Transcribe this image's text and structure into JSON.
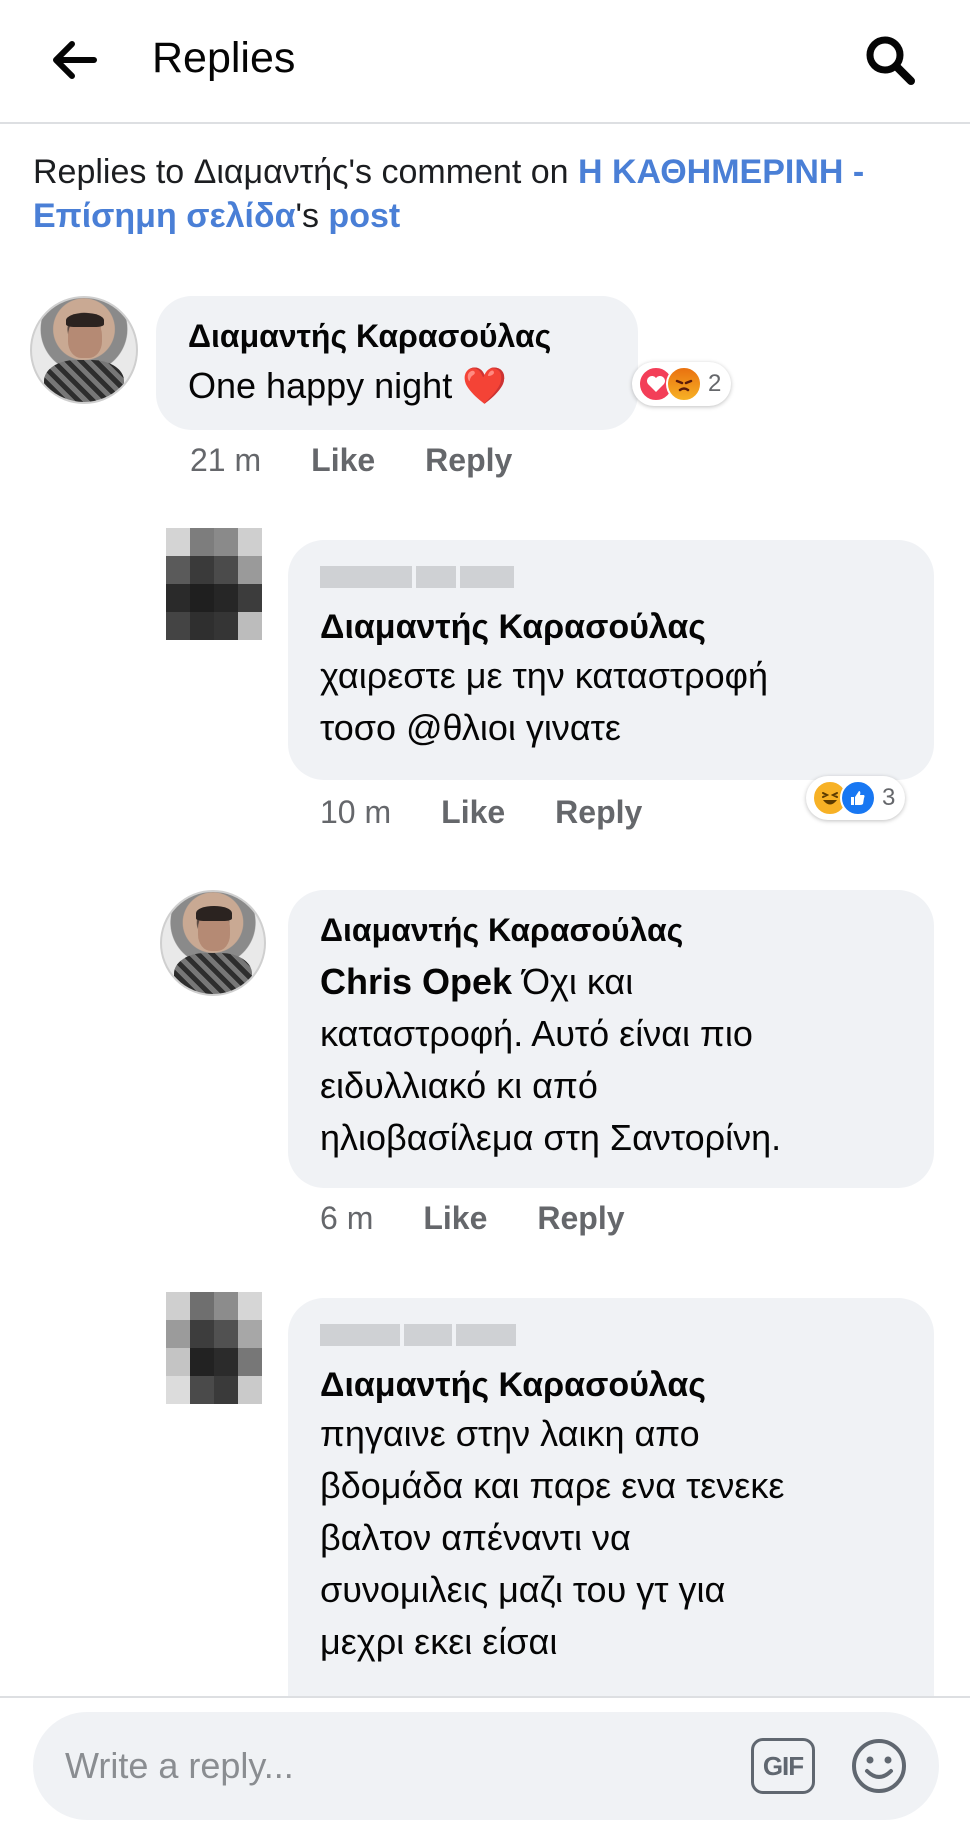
{
  "header": {
    "title": "Replies",
    "back_icon": "back-arrow-icon",
    "search_icon": "search-icon"
  },
  "context": {
    "prefix": "Replies to Διαμαντής's comment on ",
    "page_link": "Η ΚΑΘΗΜΕΡΙΝΗ - Επίσημη σελίδα",
    "middle": "'s ",
    "post_link": "post"
  },
  "colors": {
    "link": "#4a7fd6",
    "bubble": "#f0f2f5",
    "meta": "#65676b",
    "love": "#f33e58",
    "angry": "#e9710f",
    "like": "#1877f2",
    "haha": "#f7b125"
  },
  "comments": [
    {
      "author": "Διαμαντής Καρασούλας",
      "text": "One happy night ❤️",
      "time": "21 m",
      "like_label": "Like",
      "reply_label": "Reply",
      "reactions": {
        "icons": [
          "love",
          "angry"
        ],
        "count": "2"
      }
    },
    {
      "author_blurred": true,
      "tag": "Διαμαντής Καρασούλας",
      "text_lines": [
        "χαιρεστε με την καταστροφή",
        "τοσο @θλιοι γινατε"
      ],
      "time": "10 m",
      "like_label": "Like",
      "reply_label": "Reply",
      "reactions": {
        "icons": [
          "haha",
          "like"
        ],
        "count": "3"
      }
    },
    {
      "author": "Διαμαντής Καρασούλας",
      "mention": "Chris Opek",
      "text_first": " Όχι και",
      "text_lines": [
        "καταστροφή. Αυτό είναι πιο",
        "ειδυλλιακό κι από",
        "ηλιοβασίλεμα στη Σαντορίνη."
      ],
      "time": "6 m",
      "like_label": "Like",
      "reply_label": "Reply"
    },
    {
      "author_blurred": true,
      "tag": "Διαμαντής Καρασούλας",
      "text_lines": [
        "πηγαινε στην λαικη απο",
        "βδομάδα και παρε ενα τενεκε",
        "βαλτον απέναντι να",
        "συνομιλεις μαζι του γτ για",
        "μεχρι εκει είσαι"
      ]
    }
  ],
  "reply_bar": {
    "placeholder": "Write a reply...",
    "gif_label": "GIF",
    "emoji_icon": "emoji-icon"
  }
}
